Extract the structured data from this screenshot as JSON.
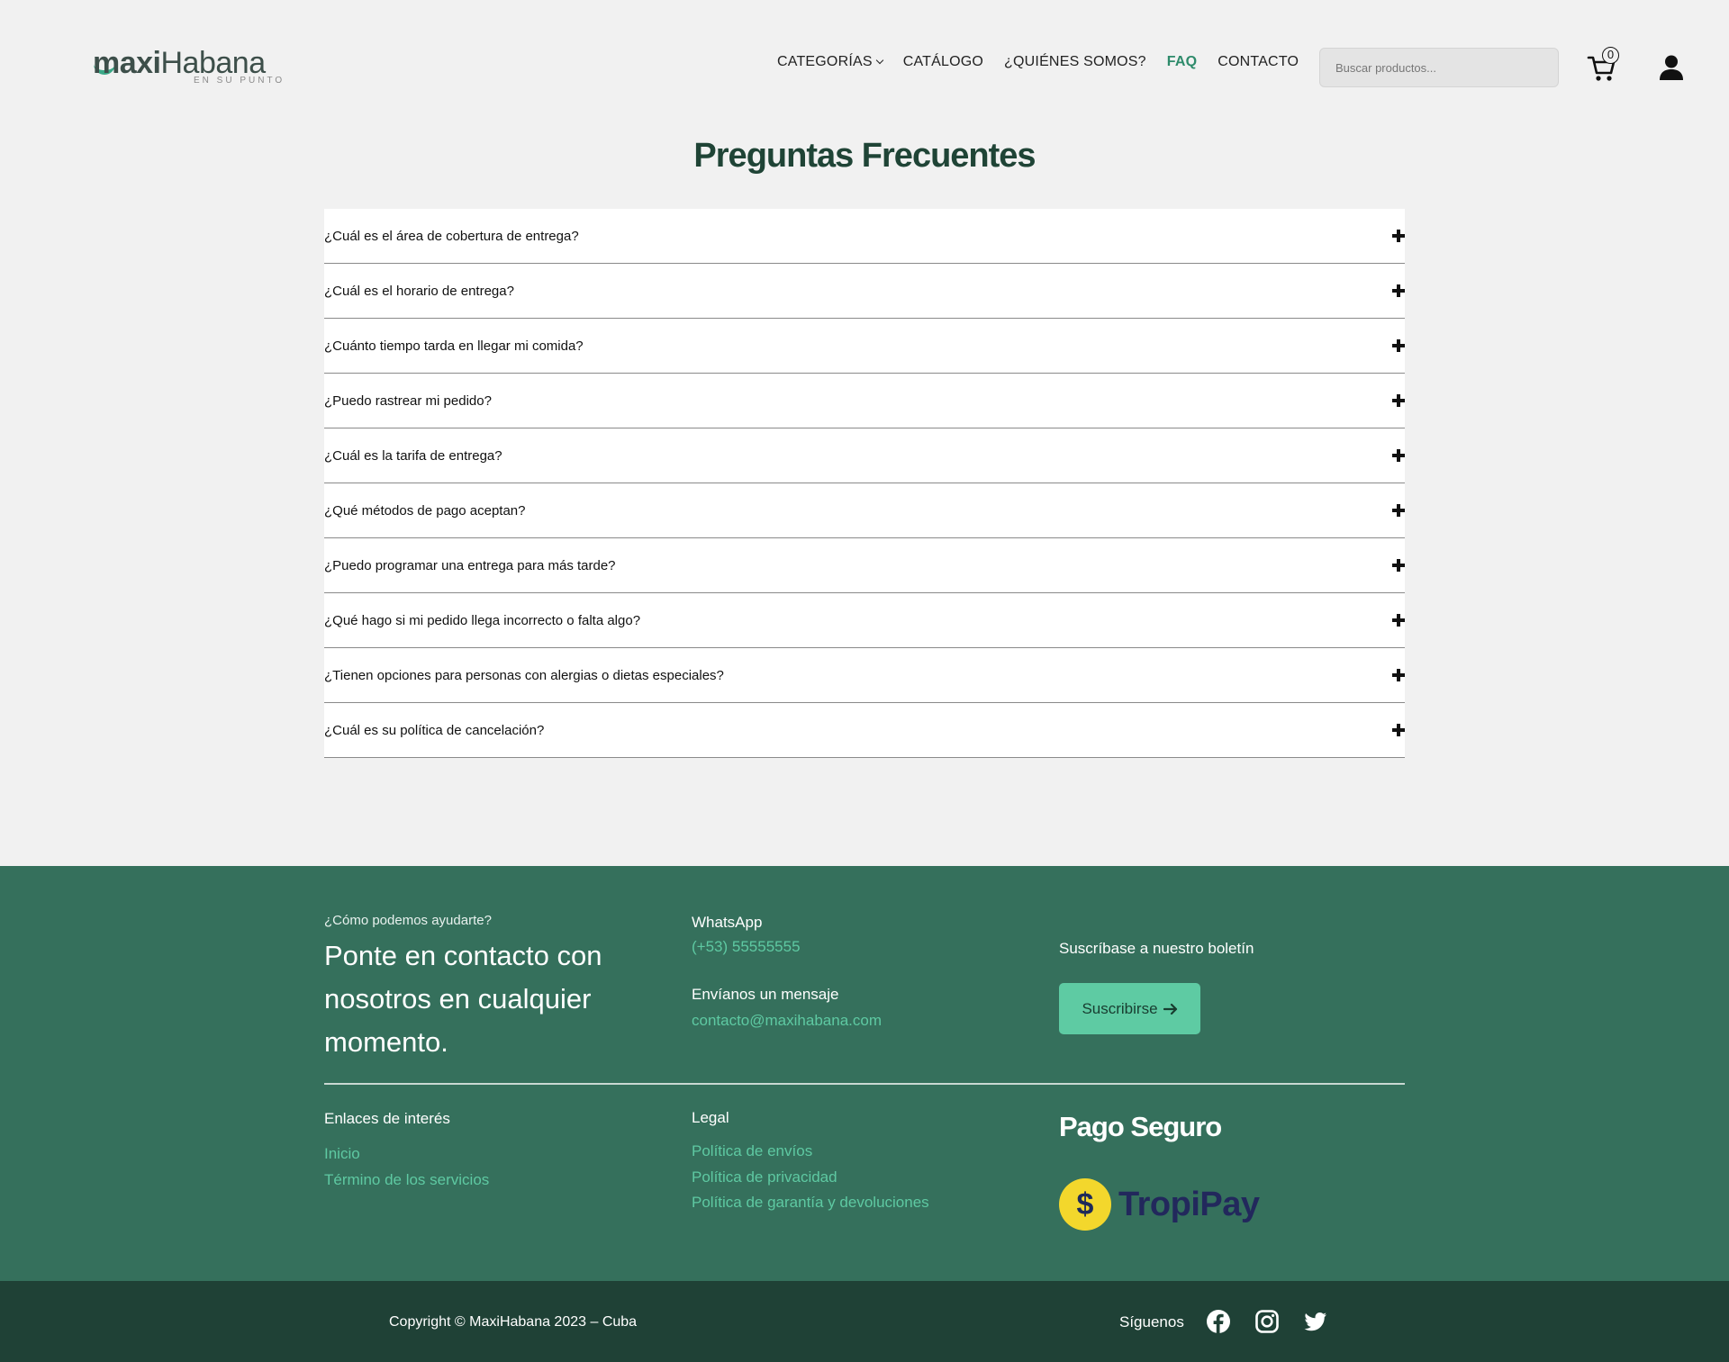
{
  "header": {
    "logo": {
      "part1": "maxi",
      "part2": "Habana",
      "tagline": "EN SU PUNTO"
    },
    "nav": [
      {
        "label": "CATEGORÍAS",
        "dropdown": true
      },
      {
        "label": "CATÁLOGO"
      },
      {
        "label": "¿QUIÉNES SOMOS?"
      },
      {
        "label": "FAQ",
        "active": true
      },
      {
        "label": "CONTACTO"
      }
    ],
    "search": {
      "placeholder": "Buscar productos...",
      "value": ""
    },
    "cart": {
      "count": "0",
      "icon": "cart-icon"
    },
    "user_icon": "user-icon"
  },
  "faq": {
    "title": "Preguntas Frecuentes",
    "items": [
      "¿Cuál es el área de cobertura de entrega?",
      "¿Cuál es el horario de entrega?",
      "¿Cuánto tiempo tarda en llegar mi comida?",
      "¿Puedo rastrear mi pedido?",
      "¿Cuál es la tarifa de entrega?",
      "¿Qué métodos de pago aceptan?",
      "¿Puedo programar una entrega para más tarde?",
      "¿Qué hago si mi pedido llega incorrecto o falta algo?",
      "¿Tienen opciones para personas con alergias o dietas especiales?",
      "¿Cuál es su política de cancelación?"
    ]
  },
  "footer": {
    "help_label": "¿Cómo podemos ayudarte?",
    "contact_text": "Ponte en contacto con nosotros en cualquier momento.",
    "whatsapp_label": "WhatsApp",
    "whatsapp_value": "(+53) 55555555",
    "message_label": "Envíanos un mensaje",
    "message_value": "contacto@maxihabana.com",
    "subscribe_label": "Suscríbase a nuestro boletín",
    "subscribe_button": "Suscribirse",
    "links_title": "Enlaces de interés",
    "links": [
      "Inicio",
      "Término de los servicios"
    ],
    "legal_title": "Legal",
    "legal_links": [
      "Política de envíos",
      "Política de privacidad",
      "Política de garantía y devoluciones"
    ],
    "secure_title": "Pago Seguro",
    "payment_logo": {
      "symbol": "$",
      "name": "TropiPay"
    }
  },
  "bottom": {
    "copyright": "Copyright © MaxiHabana 2023 – Cuba",
    "follow_label": "Síguenos",
    "social_icons": [
      "facebook-icon",
      "instagram-icon",
      "twitter-icon"
    ]
  },
  "colors": {
    "accent": "#2e8b6b",
    "footer_bg": "#35705c",
    "bottom_bg": "#1f4136",
    "link": "#5ec9a2",
    "button": "#5ecba3"
  }
}
